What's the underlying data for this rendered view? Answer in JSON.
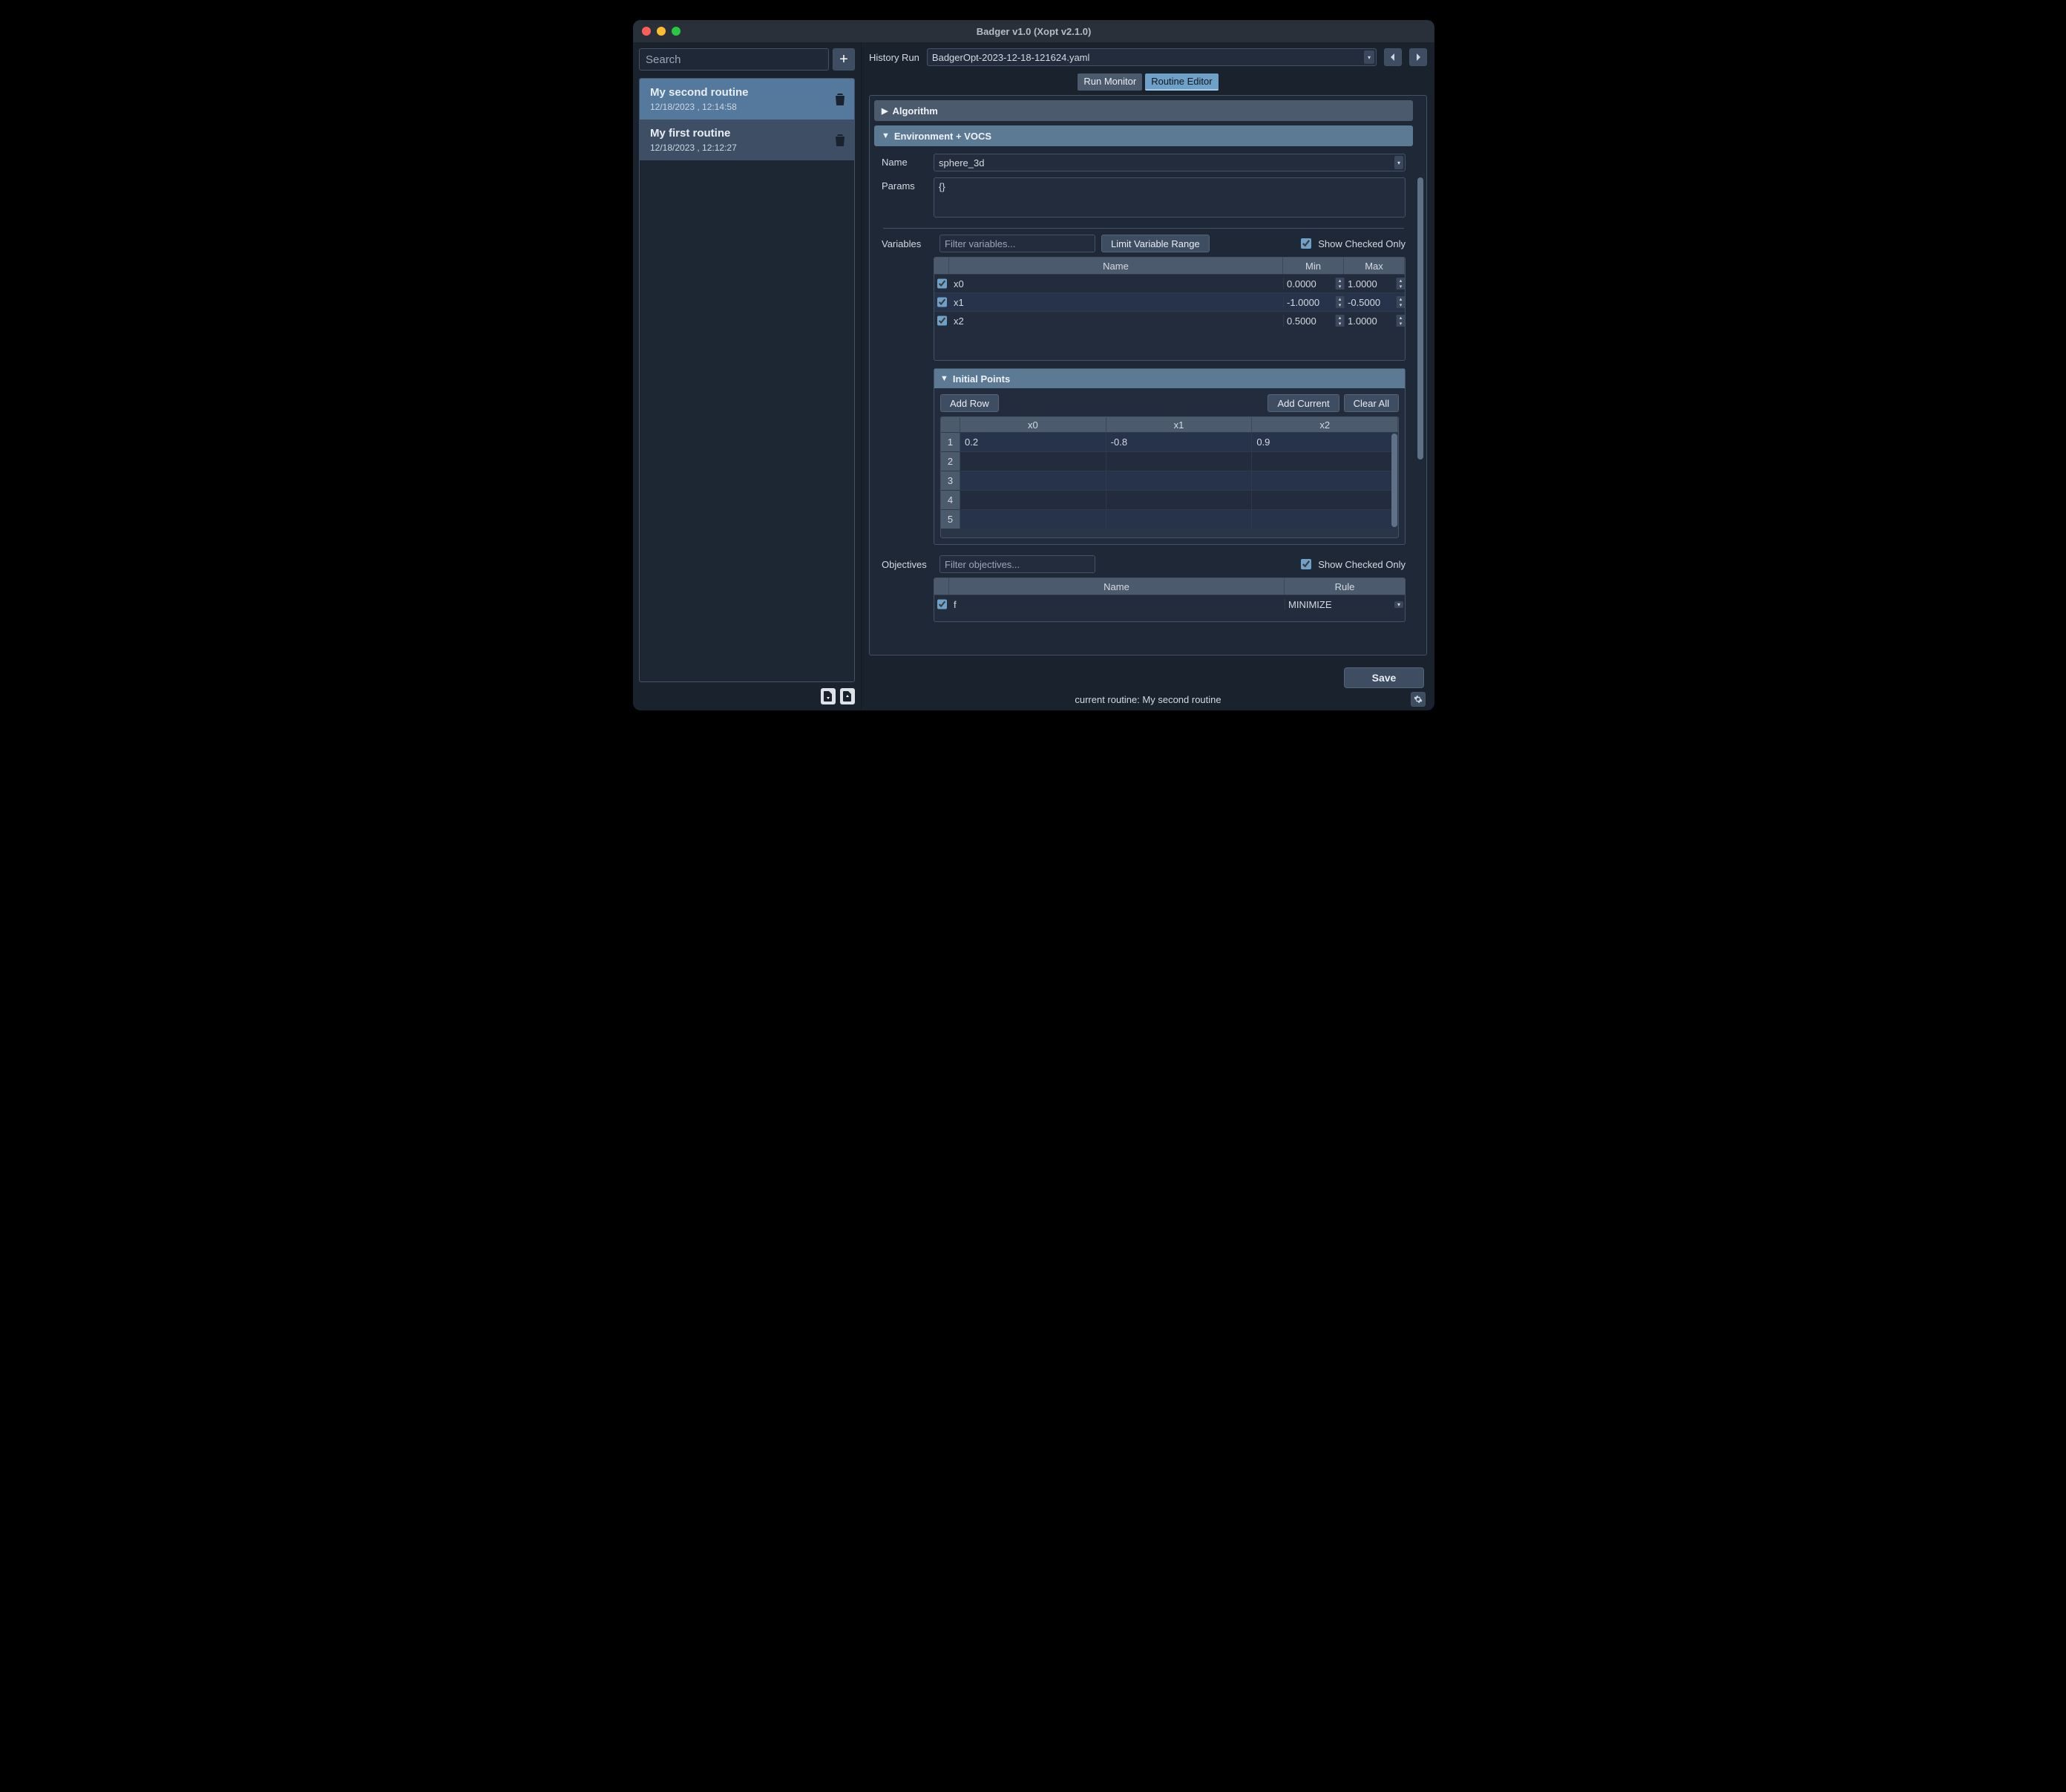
{
  "title": "Badger v1.0 (Xopt v2.1.0)",
  "sidebar": {
    "search_placeholder": "Search",
    "routines": [
      {
        "name": "My second routine",
        "ts": "12/18/2023 , 12:14:58"
      },
      {
        "name": "My first routine",
        "ts": "12/18/2023 , 12:12:27"
      }
    ]
  },
  "history": {
    "label": "History Run",
    "value": "BadgerOpt-2023-12-18-121624.yaml"
  },
  "tabs": {
    "run": "Run Monitor",
    "editor": "Routine Editor"
  },
  "sections": {
    "algorithm": "Algorithm",
    "env": "Environment + VOCS",
    "initial_points": "Initial Points"
  },
  "env": {
    "name_label": "Name",
    "name_value": "sphere_3d",
    "params_label": "Params",
    "params_value": "{}"
  },
  "variables": {
    "label": "Variables",
    "filter_placeholder": "Filter variables...",
    "limit_btn": "Limit Variable Range",
    "show_checked": "Show Checked Only",
    "headers": {
      "name": "Name",
      "min": "Min",
      "max": "Max"
    },
    "rows": [
      {
        "name": "x0",
        "min": "0.0000",
        "max": "1.0000"
      },
      {
        "name": "x1",
        "min": "-1.0000",
        "max": "-0.5000"
      },
      {
        "name": "x2",
        "min": "0.5000",
        "max": "1.0000"
      }
    ]
  },
  "initial_points": {
    "add_row": "Add Row",
    "add_current": "Add Current",
    "clear_all": "Clear All",
    "cols": [
      "x0",
      "x1",
      "x2"
    ],
    "rows": [
      {
        "n": "1",
        "v": [
          "0.2",
          "-0.8",
          "0.9"
        ]
      },
      {
        "n": "2",
        "v": [
          "",
          "",
          ""
        ]
      },
      {
        "n": "3",
        "v": [
          "",
          "",
          ""
        ]
      },
      {
        "n": "4",
        "v": [
          "",
          "",
          ""
        ]
      },
      {
        "n": "5",
        "v": [
          "",
          "",
          ""
        ]
      }
    ]
  },
  "objectives": {
    "label": "Objectives",
    "filter_placeholder": "Filter objectives...",
    "show_checked": "Show Checked Only",
    "headers": {
      "name": "Name",
      "rule": "Rule"
    },
    "rows": [
      {
        "name": "f",
        "rule": "MINIMIZE"
      }
    ]
  },
  "save": "Save",
  "status": "current routine: My second routine"
}
